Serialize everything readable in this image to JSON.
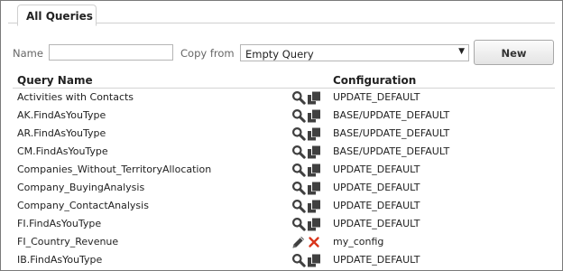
{
  "panel": {
    "tab_label": "All Queries"
  },
  "form": {
    "name_label": "Name",
    "name_value": "",
    "copy_from_label": "Copy from",
    "copy_from_selected": "Empty Query",
    "new_button_label": "New"
  },
  "table": {
    "columns": {
      "name": "Query Name",
      "configuration": "Configuration"
    },
    "rows": [
      {
        "name": "Activities with Contacts",
        "configuration": "UPDATE_DEFAULT",
        "actions": [
          "search-icon",
          "copy-icon"
        ]
      },
      {
        "name": "AK.FindAsYouType",
        "configuration": "BASE/UPDATE_DEFAULT",
        "actions": [
          "search-icon",
          "copy-icon"
        ]
      },
      {
        "name": "AR.FindAsYouType",
        "configuration": "BASE/UPDATE_DEFAULT",
        "actions": [
          "search-icon",
          "copy-icon"
        ]
      },
      {
        "name": "CM.FindAsYouType",
        "configuration": "BASE/UPDATE_DEFAULT",
        "actions": [
          "search-icon",
          "copy-icon"
        ]
      },
      {
        "name": "Companies_Without_TerritoryAllocation",
        "configuration": "UPDATE_DEFAULT",
        "actions": [
          "search-icon",
          "copy-icon"
        ]
      },
      {
        "name": "Company_BuyingAnalysis",
        "configuration": "UPDATE_DEFAULT",
        "actions": [
          "search-icon",
          "copy-icon"
        ]
      },
      {
        "name": "Company_ContactAnalysis",
        "configuration": "UPDATE_DEFAULT",
        "actions": [
          "search-icon",
          "copy-icon"
        ]
      },
      {
        "name": "FI.FindAsYouType",
        "configuration": "UPDATE_DEFAULT",
        "actions": [
          "search-icon",
          "copy-icon"
        ]
      },
      {
        "name": "FI_Country_Revenue",
        "configuration": "my_config",
        "actions": [
          "edit-icon",
          "delete-icon"
        ]
      },
      {
        "name": "IB.FindAsYouType",
        "configuration": "UPDATE_DEFAULT",
        "actions": [
          "search-icon",
          "copy-icon"
        ]
      }
    ]
  },
  "colors": {
    "delete_icon": "#d9361c",
    "icon_dark": "#404040",
    "border": "#7a7a7a"
  }
}
